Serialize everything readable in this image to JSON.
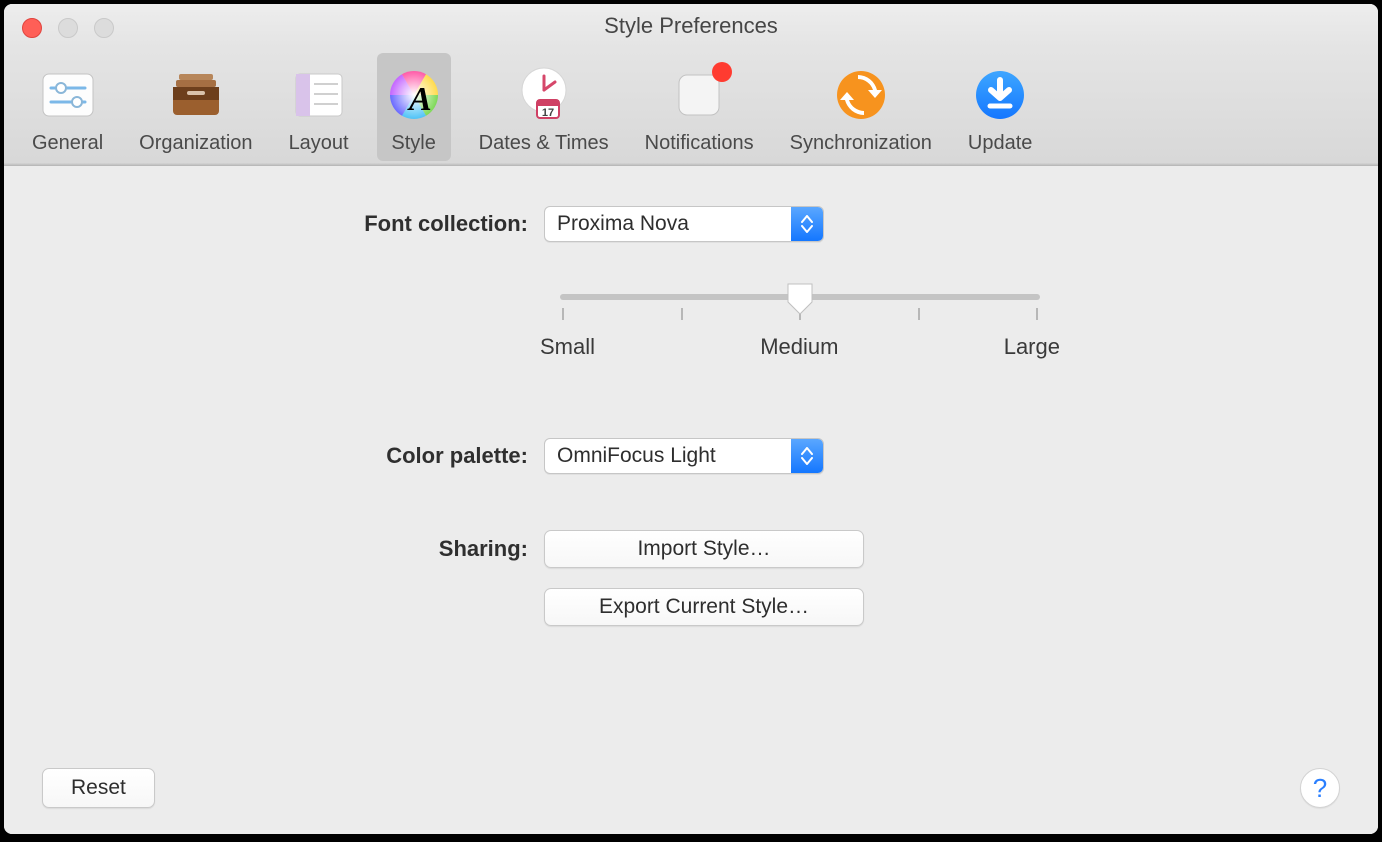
{
  "window": {
    "title": "Style Preferences"
  },
  "toolbar": {
    "items": [
      {
        "id": "general",
        "label": "General"
      },
      {
        "id": "organization",
        "label": "Organization"
      },
      {
        "id": "layout",
        "label": "Layout"
      },
      {
        "id": "style",
        "label": "Style",
        "selected": true
      },
      {
        "id": "dates-times",
        "label": "Dates & Times"
      },
      {
        "id": "notifications",
        "label": "Notifications",
        "badge": true
      },
      {
        "id": "synchronization",
        "label": "Synchronization"
      },
      {
        "id": "update",
        "label": "Update"
      }
    ]
  },
  "style": {
    "font_collection_label": "Font collection:",
    "font_collection_value": "Proxima Nova",
    "size_slider": {
      "labels": [
        "Small",
        "Medium",
        "Large"
      ],
      "value": "Medium",
      "index": 2,
      "tick_count": 5
    },
    "color_palette_label": "Color palette:",
    "color_palette_value": "OmniFocus Light",
    "sharing_label": "Sharing:",
    "import_button": "Import Style…",
    "export_button": "Export Current Style…"
  },
  "footer": {
    "reset_button": "Reset",
    "help_button": "?"
  },
  "colors": {
    "accent_blue": "#1477ff",
    "sync_orange": "#f7931e",
    "badge_red": "#ff3b30"
  }
}
